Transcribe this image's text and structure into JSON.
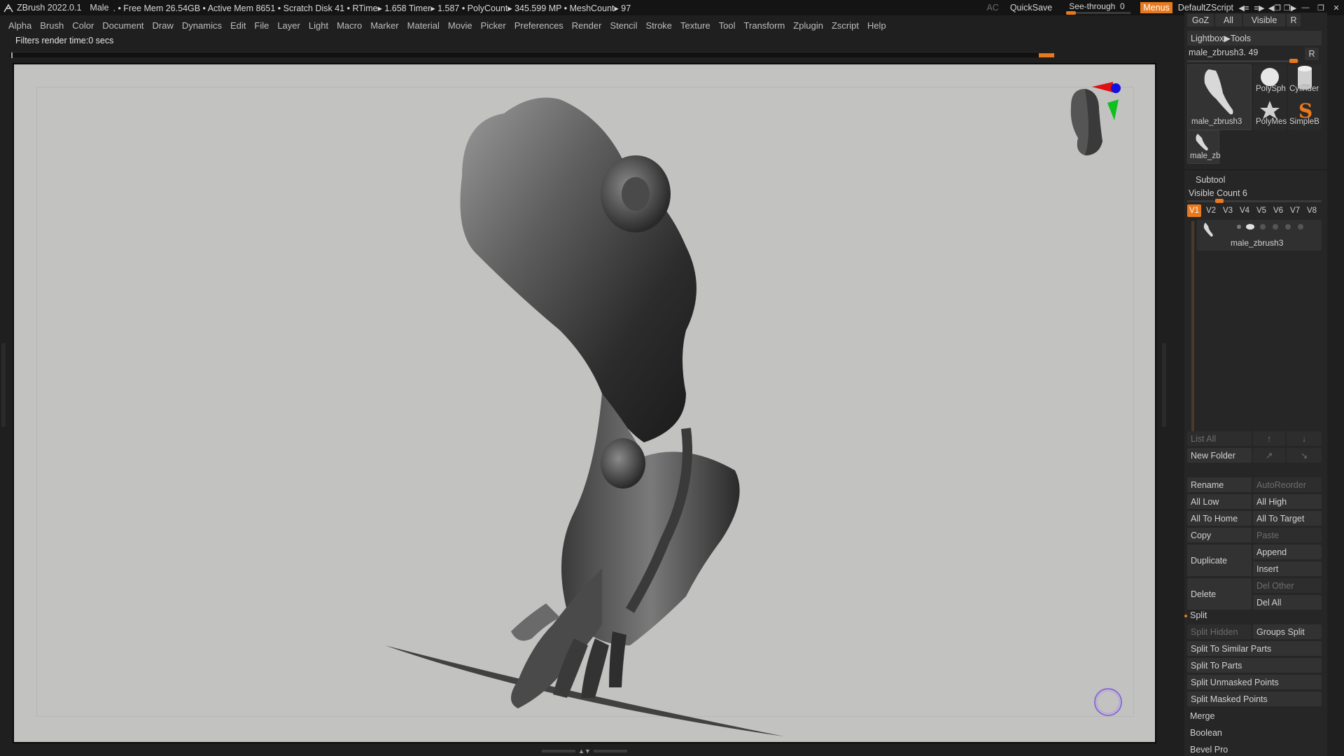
{
  "titlebar": {
    "app_title": "ZBrush 2022.0.1",
    "doc_name": "Male",
    "stats": ". • Free Mem 26.54GB • Active Mem 8651 • Scratch Disk 41 •  RTime▸ 1.658 Timer▸ 1.587 • PolyCount▸ 345.599 MP  • MeshCount▸ 97",
    "ac_label": "AC",
    "quicksave_label": "QuickSave",
    "seethrough_label": "See-through",
    "seethrough_value": "0",
    "menus_label": "Menus",
    "zscript_label": "DefaultZScript"
  },
  "menubar": {
    "items": [
      "Alpha",
      "Brush",
      "Color",
      "Document",
      "Draw",
      "Dynamics",
      "Edit",
      "File",
      "Layer",
      "Light",
      "Macro",
      "Marker",
      "Material",
      "Movie",
      "Picker",
      "Preferences",
      "Render",
      "Stencil",
      "Stroke",
      "Texture",
      "Tool",
      "Transform",
      "Zplugin",
      "Zscript",
      "Help"
    ]
  },
  "status": {
    "text": "Filters render time:0 secs"
  },
  "right_panel": {
    "top_buttons": {
      "goz": "GoZ",
      "all": "All",
      "visible": "Visible",
      "r": "R"
    },
    "lightbox_tools": "Lightbox▶Tools",
    "current_tool": "male_zbrush3. 49",
    "current_tool_r": "R",
    "tools": {
      "main_label": "male_zbrush3",
      "polysphere": "PolySph",
      "cylinder": "Cylinder",
      "polymesh": "PolyMes",
      "simpleb": "SimpleB",
      "small_label": "male_zb"
    },
    "subtool": {
      "title": "Subtool",
      "visible_count": "Visible Count 6",
      "visibility_tabs": [
        "V1",
        "V2",
        "V3",
        "V4",
        "V5",
        "V6",
        "V7",
        "V8"
      ],
      "active_tab": "V1",
      "item_name": "male_zbrush3",
      "list_all": "List All",
      "new_folder": "New Folder",
      "rename": "Rename",
      "autoreorder": "AutoReorder",
      "all_low": "All Low",
      "all_high": "All High",
      "all_to_home": "All To Home",
      "all_to_target": "All To Target",
      "copy": "Copy",
      "paste": "Paste",
      "duplicate": "Duplicate",
      "append": "Append",
      "insert": "Insert",
      "delete": "Delete",
      "del_other": "Del Other",
      "del_all": "Del All"
    },
    "split": {
      "title": "Split",
      "split_hidden": "Split Hidden",
      "groups_split": "Groups Split",
      "split_to_similar_parts": "Split To Similar Parts",
      "split_to_parts": "Split To Parts",
      "split_unmasked_points": "Split Unmasked Points",
      "split_masked_points": "Split Masked Points"
    },
    "sections": {
      "merge": "Merge",
      "boolean": "Boolean",
      "bevel_pro": "Bevel Pro"
    }
  },
  "colors": {
    "accent": "#e87a1d",
    "viewport_bg": "#c2c2c0",
    "panel_bg": "#262626",
    "titlebar_bg": "#141414"
  }
}
